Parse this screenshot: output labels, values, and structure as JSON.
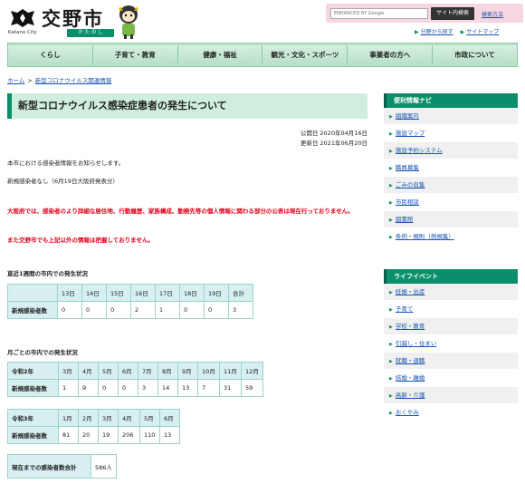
{
  "header": {
    "logo_title": "交野市",
    "logo_en": "Katano City",
    "logo_kana": "か た の し",
    "search_placeholder": "ENHANCED BY Google",
    "search_button": "サイト内検索",
    "search_help": "検索方法",
    "util_links": [
      "分野から探す",
      "サイトマップ"
    ]
  },
  "gnav": [
    "くらし",
    "子育て・教育",
    "健康・福祉",
    "観光・文化・スポーツ",
    "事業者の方へ",
    "市政について"
  ],
  "breadcrumb": [
    "ホーム",
    "新型コロナウイルス関連情報"
  ],
  "main": {
    "title": "新型コロナウイルス感染症患者の発生について",
    "published": "公開日 2020年04月16日",
    "updated": "更新日 2021年06月20日",
    "p1": "本市における感染者情報をお知らせします。",
    "p2": "新規感染者なし（6月19日大阪府発表分）",
    "red1": "大阪府では、感染者のより詳細な居住地、行動履歴、家族構成、勤務先等の個人情報に関わる部分の公表は現在行っておりません。",
    "red2": "また交野市でも上記以外の情報は把握しておりません。",
    "sec1": "直近1週間の市内での発生状況",
    "sec2": "月ごとの市内での発生状況"
  },
  "weekly": {
    "headers": [
      "",
      "13日",
      "14日",
      "15日",
      "16日",
      "17日",
      "18日",
      "19日",
      "合計"
    ],
    "row_label": "新規感染者数",
    "values": [
      "0",
      "0",
      "0",
      "2",
      "1",
      "0",
      "0",
      "3"
    ]
  },
  "monthly_r2": {
    "headers": [
      "令和2年",
      "3月",
      "4月",
      "5月",
      "6月",
      "7月",
      "8月",
      "9月",
      "10月",
      "11月",
      "12月"
    ],
    "row_label": "新規感染者数",
    "values": [
      "1",
      "9",
      "0",
      "0",
      "3",
      "14",
      "13",
      "7",
      "31",
      "59"
    ]
  },
  "monthly_r3": {
    "headers": [
      "令和3年",
      "1月",
      "2月",
      "3月",
      "4月",
      "5月",
      "6月"
    ],
    "row_label": "新規感染者数",
    "values": [
      "81",
      "20",
      "19",
      "206",
      "110",
      "13"
    ]
  },
  "total": {
    "label": "現在までの感染者数合計",
    "value": "586人"
  },
  "sidebar": {
    "nav_title": "便利情報ナビ",
    "nav_items": [
      "組織案内",
      "施設マップ",
      "施設予約システム",
      "職員募集",
      "ごみの収集",
      "市民相談",
      "図書館",
      "条例・規則（例規集）"
    ],
    "life_title": "ライフイベント",
    "life_items": [
      "妊娠・出産",
      "子育て",
      "学校・教育",
      "引越し・住まい",
      "就職・退職",
      "結婚・離婚",
      "高齢・介護",
      "おくやみ"
    ]
  },
  "colors": {
    "accent": "#0b8f6a",
    "nav_bg": "#b9e1c9",
    "title_bg": "#cfeedd",
    "alert": "#e0001a",
    "link": "#1a55b5",
    "table_head": "#d7eff0"
  }
}
